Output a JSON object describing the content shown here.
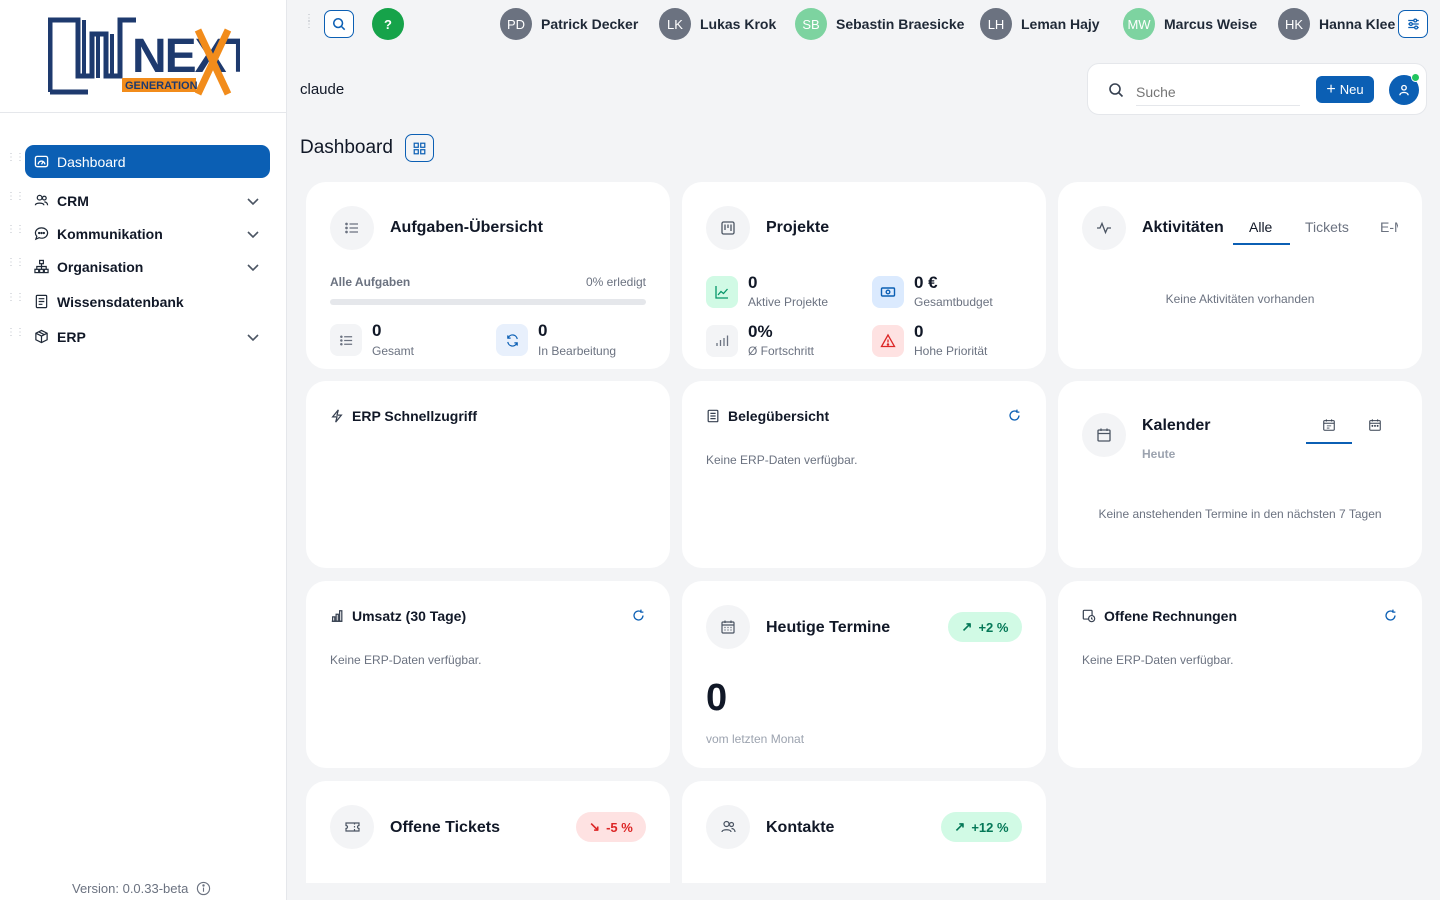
{
  "brand": {
    "logo_main": "NEXT",
    "logo_sub": "GENERATION"
  },
  "sidebar": {
    "items": [
      {
        "label": "Dashboard",
        "icon": "dashboard-gauge-icon",
        "active": true
      },
      {
        "label": "CRM",
        "icon": "users-icon"
      },
      {
        "label": "Kommunikation",
        "icon": "chat-bubble-icon"
      },
      {
        "label": "Organisation",
        "icon": "org-chart-icon"
      },
      {
        "label": "Wissensdatenbank",
        "icon": "book-icon"
      },
      {
        "label": "ERP",
        "icon": "box-icon"
      }
    ],
    "version": "Version: 0.0.33-beta"
  },
  "topbar": {
    "help_label": "?",
    "users": [
      {
        "initials": "PD",
        "name": "Patrick Decker",
        "color": "gray"
      },
      {
        "initials": "LK",
        "name": "Lukas Krok",
        "color": "gray"
      },
      {
        "initials": "SB",
        "name": "Sebastin Braesicke",
        "color": "green"
      },
      {
        "initials": "LH",
        "name": "Leman Hajy",
        "color": "gray"
      },
      {
        "initials": "MW",
        "name": "Marcus Weise",
        "color": "green"
      },
      {
        "initials": "HK",
        "name": "Hanna Klee",
        "color": "gray"
      }
    ]
  },
  "header": {
    "tenant": "claude",
    "search_placeholder": "Suche",
    "new_label": "Neu",
    "page_title": "Dashboard"
  },
  "colors": {
    "accent": "#0b5fb4",
    "success": "#16a34a",
    "bg": "#f3f4f6"
  },
  "cards": {
    "tasks": {
      "title": "Aufgaben-Übersicht",
      "progress_label": "Alle Aufgaben",
      "progress_text": "0% erledigt",
      "progress_value": 0,
      "total_value": "0",
      "total_label": "Gesamt",
      "inprogress_value": "0",
      "inprogress_label": "In Bearbeitung"
    },
    "projects": {
      "title": "Projekte",
      "active_value": "0",
      "active_label": "Aktive Projekte",
      "budget_value": "0 €",
      "budget_label": "Gesamtbudget",
      "progress_value": "0%",
      "progress_label": "Ø Fortschritt",
      "priority_value": "0",
      "priority_label": "Hohe Priorität"
    },
    "activities": {
      "title": "Aktivitäten",
      "tabs": [
        "Alle",
        "Tickets",
        "E-M"
      ],
      "empty": "Keine Aktivitäten vorhanden"
    },
    "erp_quick": {
      "title": "ERP Schnellzugriff"
    },
    "documents": {
      "title": "Belegübersicht",
      "empty": "Keine ERP-Daten verfügbar."
    },
    "calendar": {
      "title": "Kalender",
      "subtitle": "Heute",
      "empty": "Keine anstehenden Termine in den nächsten 7 Tagen"
    },
    "revenue": {
      "title": "Umsatz (30 Tage)",
      "empty": "Keine ERP-Daten verfügbar."
    },
    "appointments": {
      "title": "Heutige Termine",
      "badge": "+2 %",
      "value": "0",
      "caption": "vom letzten Monat"
    },
    "invoices": {
      "title": "Offene Rechnungen",
      "empty": "Keine ERP-Daten verfügbar."
    },
    "tickets": {
      "title": "Offene Tickets",
      "badge": "-5 %"
    },
    "contacts": {
      "title": "Kontakte",
      "badge": "+12 %"
    }
  }
}
